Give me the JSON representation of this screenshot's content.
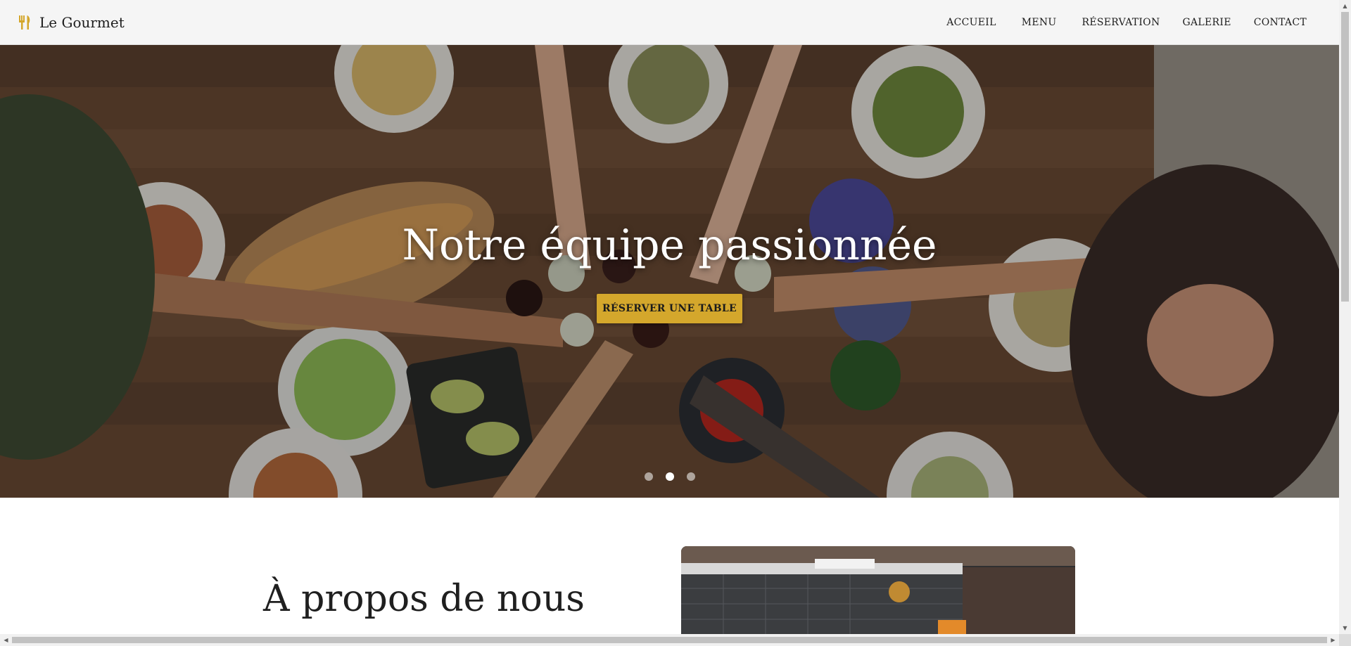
{
  "brand": {
    "name": "Le Gourmet",
    "icon": "utensils-icon",
    "accent": "#d4a72c"
  },
  "nav": {
    "items": [
      {
        "label": "ACCUEIL"
      },
      {
        "label": "MENU"
      },
      {
        "label": "RÉSERVATION"
      },
      {
        "label": "GALERIE"
      },
      {
        "label": "CONTACT"
      }
    ]
  },
  "hero": {
    "title": "Notre équipe passionnée",
    "cta_label": "RÉSERVER UNE TABLE",
    "cta_color": "#d4a72c",
    "slides_count": 3,
    "active_slide": 2
  },
  "about": {
    "title": "À propos de nous"
  }
}
